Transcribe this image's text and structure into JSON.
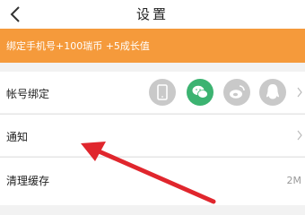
{
  "nav": {
    "title": "设置"
  },
  "banner": {
    "text": "绑定手机号+100瑞币 +5成长值"
  },
  "rows": {
    "account": {
      "label": "帐号绑定"
    },
    "notify": {
      "label": "通知"
    },
    "cache": {
      "label": "清理缓存",
      "size": "2M"
    }
  },
  "icons": {
    "back": "back-arrow-icon",
    "phone": "phone-icon",
    "wechat": "wechat-icon",
    "weibo": "weibo-icon",
    "qq": "qq-icon",
    "chevron": "chevron-right-icon"
  },
  "colors": {
    "banner": "#f59a3b",
    "wechat": "#3cb371",
    "inactive_icon": "#c9c9c9",
    "annotation_arrow": "#e0262d"
  }
}
